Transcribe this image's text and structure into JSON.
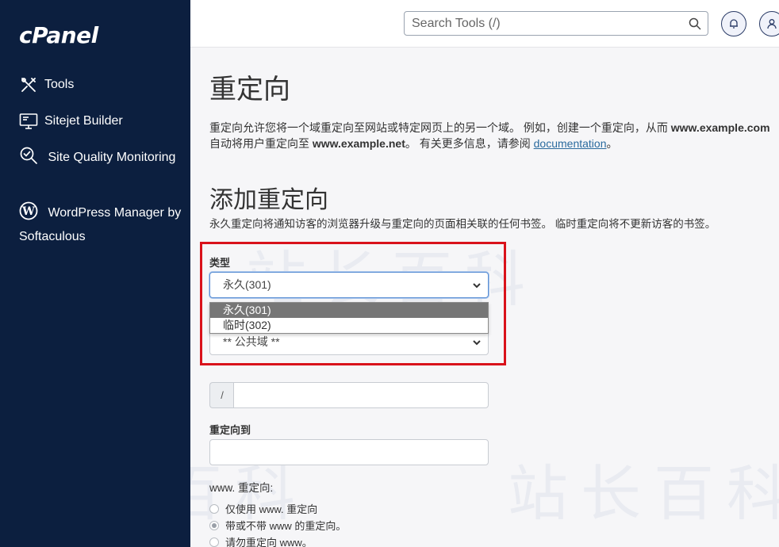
{
  "sidebar": {
    "logo": "cPanel",
    "items": [
      {
        "label": "Tools",
        "icon": "tools-icon"
      },
      {
        "label": "Sitejet Builder",
        "icon": "monitor-icon"
      },
      {
        "label": "Site Quality Monitoring",
        "icon": "magnifier-check-icon"
      },
      {
        "label": "WordPress Manager by Softaculous",
        "icon": "wordpress-icon"
      }
    ]
  },
  "header": {
    "search_placeholder": "Search Tools (/)"
  },
  "main": {
    "title": "重定向",
    "desc_part1": "重定向允许您将一个域重定向至网站或特定网页上的另一个域。 例如，创建一个重定向，从而 ",
    "desc_bold1": "www.example.com",
    "desc_part2": " 自动将用户重定向至 ",
    "desc_bold2": "www.example.net",
    "desc_part3": "。 有关更多信息，请参阅 ",
    "desc_link": "documentation",
    "desc_part4": "。",
    "add_title": "添加重定向",
    "add_desc": "永久重定向将通知访客的浏览器升级与重定向的页面相关联的任何书签。 临时重定向将不更新访客的书签。",
    "type_label": "类型",
    "type_selected": "永久(301)",
    "type_options": [
      "永久(301)",
      "临时(302)"
    ],
    "domain_selected": "** 公共域 **",
    "path_prefix": "/",
    "redirect_to_label": "重定向到",
    "www_label": "www. 重定向:",
    "www_options": [
      {
        "label": "仅使用 www. 重定向",
        "checked": false
      },
      {
        "label": "带或不带 www 的重定向。",
        "checked": true
      },
      {
        "label": "请勿重定向 www。",
        "checked": false
      }
    ]
  },
  "colors": {
    "sidebar_bg": "#0c1f3f",
    "highlight_box": "#d9121b",
    "link": "#2a6a9e"
  }
}
